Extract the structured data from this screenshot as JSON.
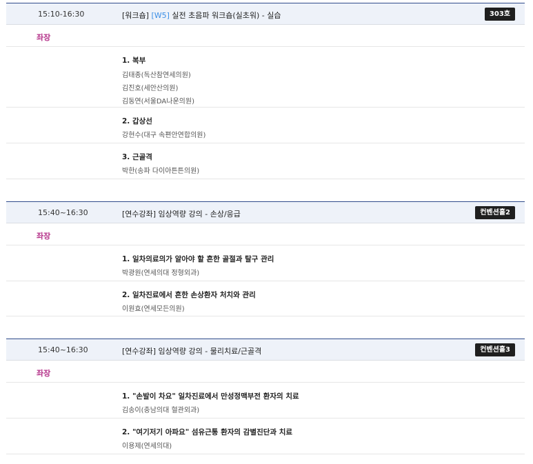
{
  "sessions": [
    {
      "time": "15:10-16:30",
      "title_prefix": "[워크숍] ",
      "title_tag": "[W5]",
      "title_rest": " 실전 초음파 워크숍(실초워) - 실습",
      "room": "303호",
      "chair_label": "좌장",
      "talks": [
        {
          "title": "1. 복부",
          "speakers": [
            "김태종(독산참연세의원)",
            "김진호(세안산의원)",
            "김동연(서울DA나운의원)"
          ]
        },
        {
          "title": "2. 갑상선",
          "speakers": [
            "강현수(대구 속편안연합의원)"
          ]
        },
        {
          "title": "3. 근골격",
          "speakers": [
            "박한(송파 다이아튼튼의원)"
          ]
        }
      ]
    },
    {
      "time": "15:40~16:30",
      "title": "[연수강좌] 임상역량 강의 - 손상/응급",
      "room": "컨벤션홀2",
      "chair_label": "좌장",
      "talks": [
        {
          "title": "1. 일차의료의가 알아야 할 흔한 골절과 탈구 관리",
          "speakers": [
            "박광원(연세의대 정형외과)"
          ]
        },
        {
          "title": "2. 일차진료에서 흔한 손상환자 처치와 관리",
          "speakers": [
            "이원효(연세모든의원)"
          ]
        }
      ]
    },
    {
      "time": "15:40~16:30",
      "title": "[연수강좌] 임상역량 강의 - 물리치료/근골격",
      "room": "컨벤션홀3",
      "chair_label": "좌장",
      "talks": [
        {
          "title": "1. \"손발이 차요\" 일차진료에서 만성정맥부전 환자의 치료",
          "speakers": [
            "김송이(충남의대 혈관외과)"
          ]
        },
        {
          "title": "2. \"여기저기 아파요\" 섬유근통 환자의 감별진단과 치료",
          "speakers": [
            "이용제(연세의대)"
          ]
        }
      ]
    }
  ]
}
